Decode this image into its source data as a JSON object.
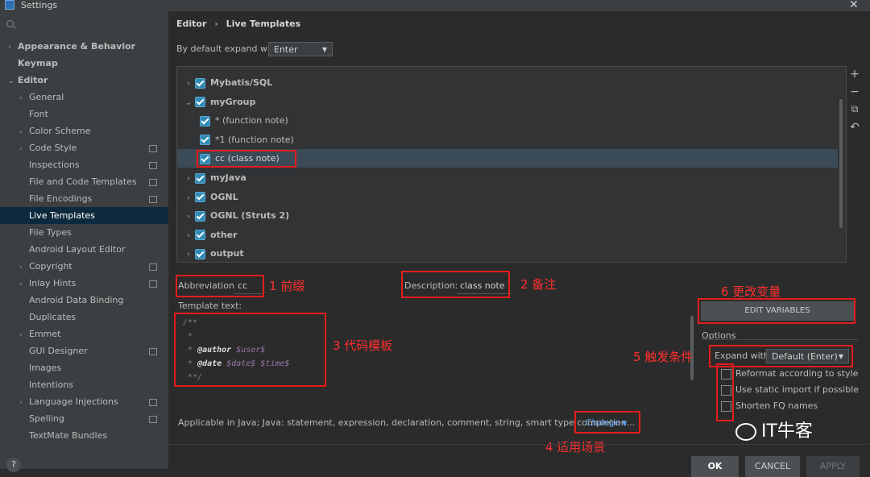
{
  "window": {
    "title": "Settings",
    "close_glyph": "✕"
  },
  "sidebar": {
    "items": [
      {
        "label": "Appearance & Behavior",
        "arrow": "›",
        "bold": true,
        "indent": 0,
        "copy": false
      },
      {
        "label": "Keymap",
        "arrow": "",
        "bold": true,
        "indent": 0,
        "copy": false
      },
      {
        "label": "Editor",
        "arrow": "⌄",
        "bold": true,
        "indent": 0,
        "copy": false
      },
      {
        "label": "General",
        "arrow": "›",
        "bold": false,
        "indent": 1,
        "copy": false
      },
      {
        "label": "Font",
        "arrow": "",
        "bold": false,
        "indent": 1,
        "copy": false
      },
      {
        "label": "Color Scheme",
        "arrow": "›",
        "bold": false,
        "indent": 1,
        "copy": false
      },
      {
        "label": "Code Style",
        "arrow": "›",
        "bold": false,
        "indent": 1,
        "copy": true
      },
      {
        "label": "Inspections",
        "arrow": "",
        "bold": false,
        "indent": 1,
        "copy": true
      },
      {
        "label": "File and Code Templates",
        "arrow": "",
        "bold": false,
        "indent": 1,
        "copy": true
      },
      {
        "label": "File Encodings",
        "arrow": "",
        "bold": false,
        "indent": 1,
        "copy": true
      },
      {
        "label": "Live Templates",
        "arrow": "",
        "bold": false,
        "indent": 1,
        "copy": false,
        "selected": true
      },
      {
        "label": "File Types",
        "arrow": "",
        "bold": false,
        "indent": 1,
        "copy": false
      },
      {
        "label": "Android Layout Editor",
        "arrow": "",
        "bold": false,
        "indent": 1,
        "copy": false
      },
      {
        "label": "Copyright",
        "arrow": "›",
        "bold": false,
        "indent": 1,
        "copy": true
      },
      {
        "label": "Inlay Hints",
        "arrow": "›",
        "bold": false,
        "indent": 1,
        "copy": true
      },
      {
        "label": "Android Data Binding",
        "arrow": "",
        "bold": false,
        "indent": 1,
        "copy": false
      },
      {
        "label": "Duplicates",
        "arrow": "",
        "bold": false,
        "indent": 1,
        "copy": false
      },
      {
        "label": "Emmet",
        "arrow": "›",
        "bold": false,
        "indent": 1,
        "copy": false
      },
      {
        "label": "GUI Designer",
        "arrow": "",
        "bold": false,
        "indent": 1,
        "copy": true
      },
      {
        "label": "Images",
        "arrow": "",
        "bold": false,
        "indent": 1,
        "copy": false
      },
      {
        "label": "Intentions",
        "arrow": "",
        "bold": false,
        "indent": 1,
        "copy": false
      },
      {
        "label": "Language Injections",
        "arrow": "›",
        "bold": false,
        "indent": 1,
        "copy": true
      },
      {
        "label": "Spelling",
        "arrow": "",
        "bold": false,
        "indent": 1,
        "copy": true
      },
      {
        "label": "TextMate Bundles",
        "arrow": "",
        "bold": false,
        "indent": 1,
        "copy": false
      }
    ],
    "help_label": "?"
  },
  "breadcrumb": {
    "part1": "Editor",
    "sep": "›",
    "part2": "Live Templates"
  },
  "expand_default": {
    "label": "By default expand with",
    "value": "Enter"
  },
  "templates": [
    {
      "label": "Mybatis/SQL",
      "arrow": "›",
      "group": true,
      "indent": 0
    },
    {
      "label": "myGroup",
      "arrow": "⌄",
      "group": true,
      "indent": 0
    },
    {
      "label": "* (function note)",
      "arrow": "",
      "group": false,
      "indent": 1
    },
    {
      "label": "*1 (function note)",
      "arrow": "",
      "group": false,
      "indent": 1
    },
    {
      "label": "cc (class note)",
      "arrow": "",
      "group": false,
      "indent": 1,
      "selected": true
    },
    {
      "label": "myJava",
      "arrow": "›",
      "group": true,
      "indent": 0
    },
    {
      "label": "OGNL",
      "arrow": "›",
      "group": true,
      "indent": 0
    },
    {
      "label": "OGNL (Struts 2)",
      "arrow": "›",
      "group": true,
      "indent": 0
    },
    {
      "label": "other",
      "arrow": "›",
      "group": true,
      "indent": 0
    },
    {
      "label": "output",
      "arrow": "›",
      "group": true,
      "indent": 0
    }
  ],
  "toolbar": {
    "add": "+",
    "remove": "−",
    "copy": "⧉",
    "revert": "↶"
  },
  "abbreviation": {
    "label": "Abbreviation:",
    "value": "cc"
  },
  "description": {
    "label": "Description:",
    "value": "class note"
  },
  "template_text": {
    "label": "Template text:",
    "lines": [
      {
        "c": "/**"
      },
      {
        "c": " *"
      },
      {
        "c": " * ",
        "tag": "@author",
        "var": " $user$"
      },
      {
        "c": " * ",
        "tag": "@date",
        "var": " $date$ $time$"
      },
      {
        "c": " **/"
      }
    ]
  },
  "edit_variables": "EDIT VARIABLES",
  "options": {
    "title": "Options",
    "expand_label": "Expand with",
    "expand_value": "Default (Enter)",
    "checks": [
      "Reformat according to style",
      "Use static import if possible",
      "Shorten FQ names"
    ]
  },
  "applicable": {
    "text": "Applicable in Java; Java: statement, expression, declaration, comment, string, smart type completion...",
    "change": "Change"
  },
  "buttons": {
    "ok": "OK",
    "cancel": "CANCEL",
    "apply": "APPLY"
  },
  "annotations": {
    "a1": "1 前缀",
    "a2": "2 备注",
    "a3": "3 代码模板",
    "a4": "4 适用场景",
    "a5": "5 触发条件",
    "a6": "6 更改变量"
  },
  "watermark": "IT牛客",
  "colors": {
    "accent_red": "#e31d1d",
    "checkbox_blue": "#2e8ab4",
    "selection": "#0d293e",
    "link": "#589df6"
  }
}
